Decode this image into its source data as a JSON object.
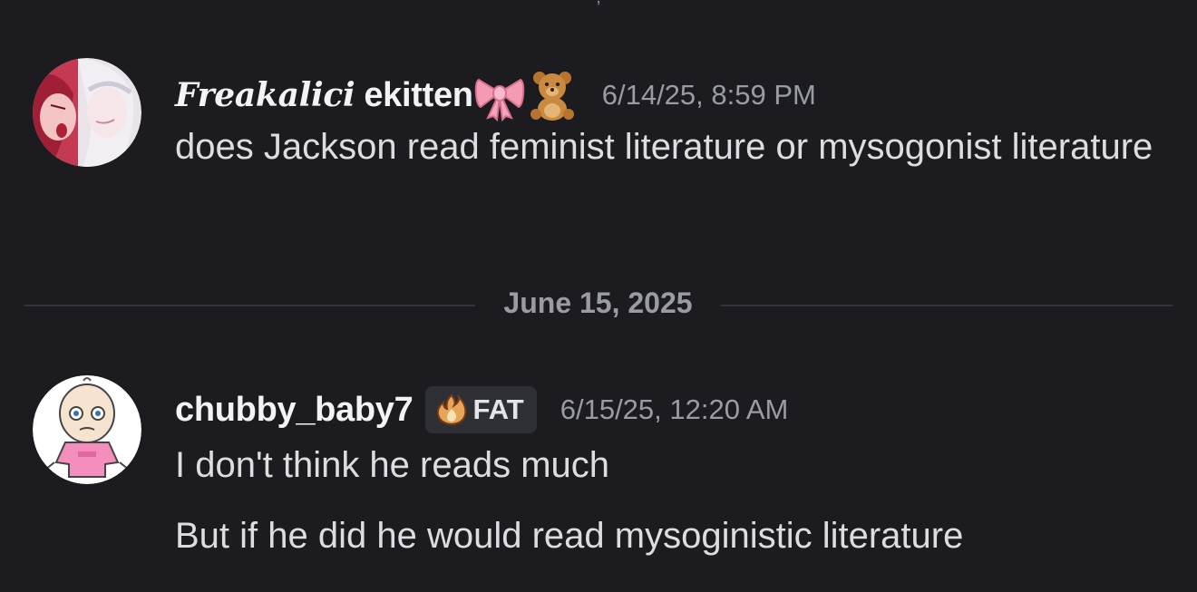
{
  "messages": [
    {
      "username_script": "Freakalici",
      "username_plain": "ekitten",
      "emojis": [
        "ribbon-emoji",
        "teddy-bear-emoji"
      ],
      "timestamp": "6/14/25, 8:59 PM",
      "lines": [
        "does Jackson read feminist literature or mysogonist literature"
      ]
    },
    {
      "username_plain": "chubby_baby7",
      "tag_icon": "flame-icon",
      "tag": "FAT",
      "timestamp": "6/15/25, 12:20 AM",
      "lines": [
        "I don't think he reads much",
        "But if he did he would read mysoginistic literature"
      ]
    }
  ],
  "divider": {
    "date": "June 15, 2025"
  },
  "colors": {
    "background": "#1b1b20",
    "username": "#f2f3f5",
    "text": "#dcdde1",
    "timestamp": "#9a9ca4",
    "divider": "#34353b",
    "tag_bg": "#2f3035"
  }
}
